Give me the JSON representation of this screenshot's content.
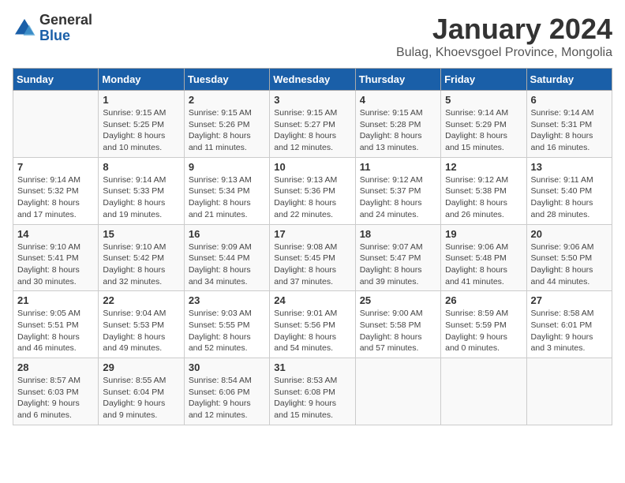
{
  "header": {
    "logo_general": "General",
    "logo_blue": "Blue",
    "main_title": "January 2024",
    "subtitle": "Bulag, Khoevsgoel Province, Mongolia"
  },
  "days_of_week": [
    "Sunday",
    "Monday",
    "Tuesday",
    "Wednesday",
    "Thursday",
    "Friday",
    "Saturday"
  ],
  "weeks": [
    [
      {
        "day": "",
        "info": ""
      },
      {
        "day": "1",
        "info": "Sunrise: 9:15 AM\nSunset: 5:25 PM\nDaylight: 8 hours\nand 10 minutes."
      },
      {
        "day": "2",
        "info": "Sunrise: 9:15 AM\nSunset: 5:26 PM\nDaylight: 8 hours\nand 11 minutes."
      },
      {
        "day": "3",
        "info": "Sunrise: 9:15 AM\nSunset: 5:27 PM\nDaylight: 8 hours\nand 12 minutes."
      },
      {
        "day": "4",
        "info": "Sunrise: 9:15 AM\nSunset: 5:28 PM\nDaylight: 8 hours\nand 13 minutes."
      },
      {
        "day": "5",
        "info": "Sunrise: 9:14 AM\nSunset: 5:29 PM\nDaylight: 8 hours\nand 15 minutes."
      },
      {
        "day": "6",
        "info": "Sunrise: 9:14 AM\nSunset: 5:31 PM\nDaylight: 8 hours\nand 16 minutes."
      }
    ],
    [
      {
        "day": "7",
        "info": "Sunrise: 9:14 AM\nSunset: 5:32 PM\nDaylight: 8 hours\nand 17 minutes."
      },
      {
        "day": "8",
        "info": "Sunrise: 9:14 AM\nSunset: 5:33 PM\nDaylight: 8 hours\nand 19 minutes."
      },
      {
        "day": "9",
        "info": "Sunrise: 9:13 AM\nSunset: 5:34 PM\nDaylight: 8 hours\nand 21 minutes."
      },
      {
        "day": "10",
        "info": "Sunrise: 9:13 AM\nSunset: 5:36 PM\nDaylight: 8 hours\nand 22 minutes."
      },
      {
        "day": "11",
        "info": "Sunrise: 9:12 AM\nSunset: 5:37 PM\nDaylight: 8 hours\nand 24 minutes."
      },
      {
        "day": "12",
        "info": "Sunrise: 9:12 AM\nSunset: 5:38 PM\nDaylight: 8 hours\nand 26 minutes."
      },
      {
        "day": "13",
        "info": "Sunrise: 9:11 AM\nSunset: 5:40 PM\nDaylight: 8 hours\nand 28 minutes."
      }
    ],
    [
      {
        "day": "14",
        "info": "Sunrise: 9:10 AM\nSunset: 5:41 PM\nDaylight: 8 hours\nand 30 minutes."
      },
      {
        "day": "15",
        "info": "Sunrise: 9:10 AM\nSunset: 5:42 PM\nDaylight: 8 hours\nand 32 minutes."
      },
      {
        "day": "16",
        "info": "Sunrise: 9:09 AM\nSunset: 5:44 PM\nDaylight: 8 hours\nand 34 minutes."
      },
      {
        "day": "17",
        "info": "Sunrise: 9:08 AM\nSunset: 5:45 PM\nDaylight: 8 hours\nand 37 minutes."
      },
      {
        "day": "18",
        "info": "Sunrise: 9:07 AM\nSunset: 5:47 PM\nDaylight: 8 hours\nand 39 minutes."
      },
      {
        "day": "19",
        "info": "Sunrise: 9:06 AM\nSunset: 5:48 PM\nDaylight: 8 hours\nand 41 minutes."
      },
      {
        "day": "20",
        "info": "Sunrise: 9:06 AM\nSunset: 5:50 PM\nDaylight: 8 hours\nand 44 minutes."
      }
    ],
    [
      {
        "day": "21",
        "info": "Sunrise: 9:05 AM\nSunset: 5:51 PM\nDaylight: 8 hours\nand 46 minutes."
      },
      {
        "day": "22",
        "info": "Sunrise: 9:04 AM\nSunset: 5:53 PM\nDaylight: 8 hours\nand 49 minutes."
      },
      {
        "day": "23",
        "info": "Sunrise: 9:03 AM\nSunset: 5:55 PM\nDaylight: 8 hours\nand 52 minutes."
      },
      {
        "day": "24",
        "info": "Sunrise: 9:01 AM\nSunset: 5:56 PM\nDaylight: 8 hours\nand 54 minutes."
      },
      {
        "day": "25",
        "info": "Sunrise: 9:00 AM\nSunset: 5:58 PM\nDaylight: 8 hours\nand 57 minutes."
      },
      {
        "day": "26",
        "info": "Sunrise: 8:59 AM\nSunset: 5:59 PM\nDaylight: 9 hours\nand 0 minutes."
      },
      {
        "day": "27",
        "info": "Sunrise: 8:58 AM\nSunset: 6:01 PM\nDaylight: 9 hours\nand 3 minutes."
      }
    ],
    [
      {
        "day": "28",
        "info": "Sunrise: 8:57 AM\nSunset: 6:03 PM\nDaylight: 9 hours\nand 6 minutes."
      },
      {
        "day": "29",
        "info": "Sunrise: 8:55 AM\nSunset: 6:04 PM\nDaylight: 9 hours\nand 9 minutes."
      },
      {
        "day": "30",
        "info": "Sunrise: 8:54 AM\nSunset: 6:06 PM\nDaylight: 9 hours\nand 12 minutes."
      },
      {
        "day": "31",
        "info": "Sunrise: 8:53 AM\nSunset: 6:08 PM\nDaylight: 9 hours\nand 15 minutes."
      },
      {
        "day": "",
        "info": ""
      },
      {
        "day": "",
        "info": ""
      },
      {
        "day": "",
        "info": ""
      }
    ]
  ]
}
